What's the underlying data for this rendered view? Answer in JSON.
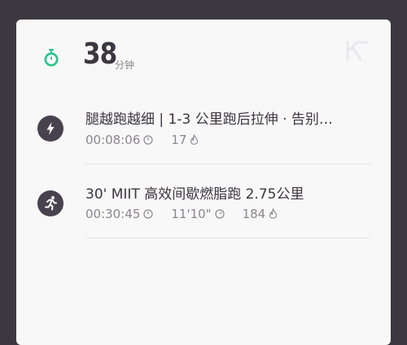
{
  "summary": {
    "total_value": "38",
    "total_unit": "分钟",
    "icon": "stopwatch-icon",
    "brand_icon": "keep-logo-icon"
  },
  "workouts": [
    {
      "icon": "lightning-icon",
      "title": "腿越跑越细 | 1-3 公里跑后拉伸 · 告别…",
      "duration": "00:08:06",
      "duration_icon": "clock-icon",
      "calories": "17",
      "calories_icon": "flame-icon"
    },
    {
      "icon": "runner-icon",
      "title": "30' MIIT 高效间歇燃脂跑 2.75公里",
      "duration": "00:30:45",
      "duration_icon": "clock-icon",
      "pace": "11'10\"",
      "pace_icon": "pace-gauge-icon",
      "calories": "184",
      "calories_icon": "flame-icon"
    }
  ],
  "colors": {
    "background": "#3d3840",
    "card": "#f8f8f8",
    "accent": "#24c789",
    "icon_circle": "#48424e"
  }
}
